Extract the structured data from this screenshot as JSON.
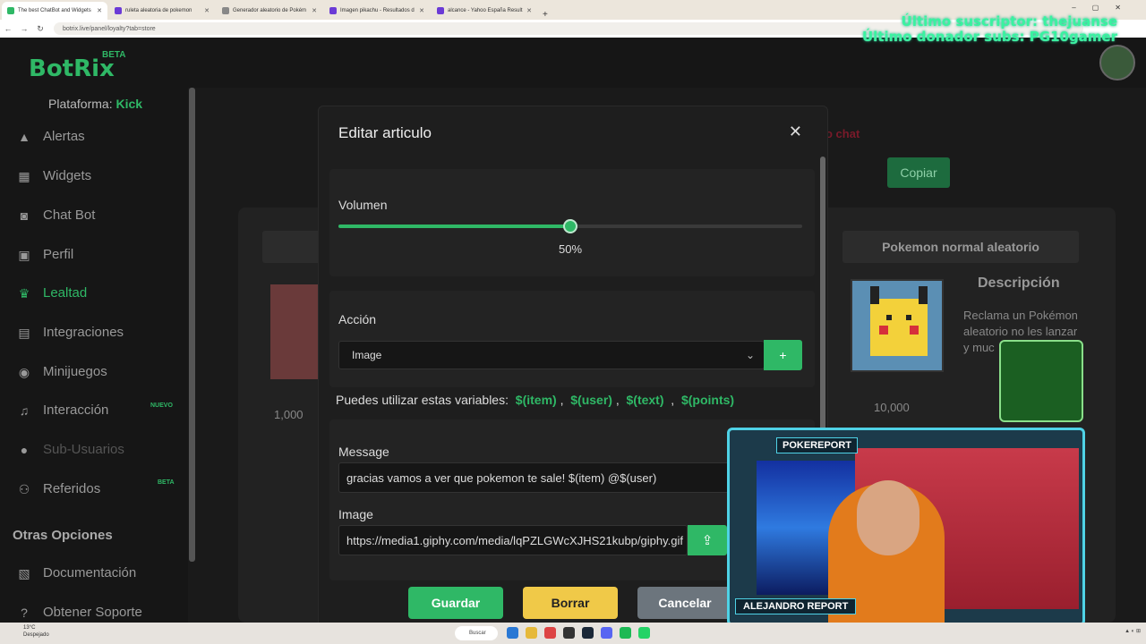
{
  "browser": {
    "tabs": [
      {
        "title": "The best ChatBot and Widgets",
        "active": true
      },
      {
        "title": "ruleta aleatoria de pokemon",
        "active": false
      },
      {
        "title": "Generador aleatorio de Pokém",
        "active": false
      },
      {
        "title": "Imagen pikachu - Resultados d",
        "active": false
      },
      {
        "title": "alcance - Yahoo España Result",
        "active": false
      }
    ],
    "url": "botrix.live/panel/loyalty?tab=store"
  },
  "overlay": {
    "line1": "Último suscriptor: thejuanse",
    "line2": "Último donador subs: PG10gamer"
  },
  "app": {
    "brand": "BotRix",
    "beta": "BETA",
    "platform_label": "Plataforma:",
    "platform_value": "Kick"
  },
  "sidebar": {
    "items": [
      {
        "label": "Alertas",
        "icon": "warning-icon"
      },
      {
        "label": "Widgets",
        "icon": "grid-icon"
      },
      {
        "label": "Chat Bot",
        "icon": "robot-icon"
      },
      {
        "label": "Perfil",
        "icon": "id-card-icon"
      },
      {
        "label": "Lealtad",
        "icon": "trophy-icon",
        "active": true
      },
      {
        "label": "Integraciones",
        "icon": "integration-icon"
      },
      {
        "label": "Minijuegos",
        "icon": "gamepad-icon"
      },
      {
        "label": "Interacción",
        "icon": "music-icon",
        "tag": "NUEVO"
      },
      {
        "label": "Sub-Usuarios",
        "icon": "users-icon",
        "dim": true
      },
      {
        "label": "Referidos",
        "icon": "referral-icon",
        "tag": "BETA"
      }
    ],
    "other_heading": "Otras Opciones",
    "other_items": [
      {
        "label": "Documentación",
        "icon": "docs-icon"
      },
      {
        "label": "Obtener Soporte",
        "icon": "help-icon"
      }
    ]
  },
  "background": {
    "red_text": "o chat",
    "copy_label": "Copiar",
    "product_title": "Pokemon normal aleatorio",
    "product_desc_heading": "Descripción",
    "product_desc": "Reclama un Pokémon aleatorio no les lanzar y muc",
    "product_price": "10,000",
    "left_price": "1,000"
  },
  "modal": {
    "title": "Editar articulo",
    "volume_label": "Volumen",
    "volume_value": 50,
    "volume_text": "50%",
    "action_label": "Acción",
    "action_selected": "Image",
    "vars_prefix": "Puedes utilizar estas variables:",
    "vars": [
      "$(item)",
      "$(user)",
      "$(text)",
      "$(points)"
    ],
    "message_label": "Message",
    "message_value": "gracias vamos a ver que pokemon te sale! $(item) @$(user)",
    "image_label": "Image",
    "image_value": "https://media1.giphy.com/media/lqPZLGWcXJHS21kubp/giphy.gif",
    "save": "Guardar",
    "delete": "Borrar",
    "cancel": "Cancelar"
  },
  "stream": {
    "top_label": "POKEREPORT",
    "bottom_label": "ALEJANDRO REPORT"
  },
  "taskbar": {
    "weather_temp": "13°C",
    "weather_desc": "Despejado",
    "search": "Buscar"
  },
  "colors": {
    "accent": "#2fb866",
    "warning": "#f0c948",
    "neutral_btn": "#6c757d"
  }
}
